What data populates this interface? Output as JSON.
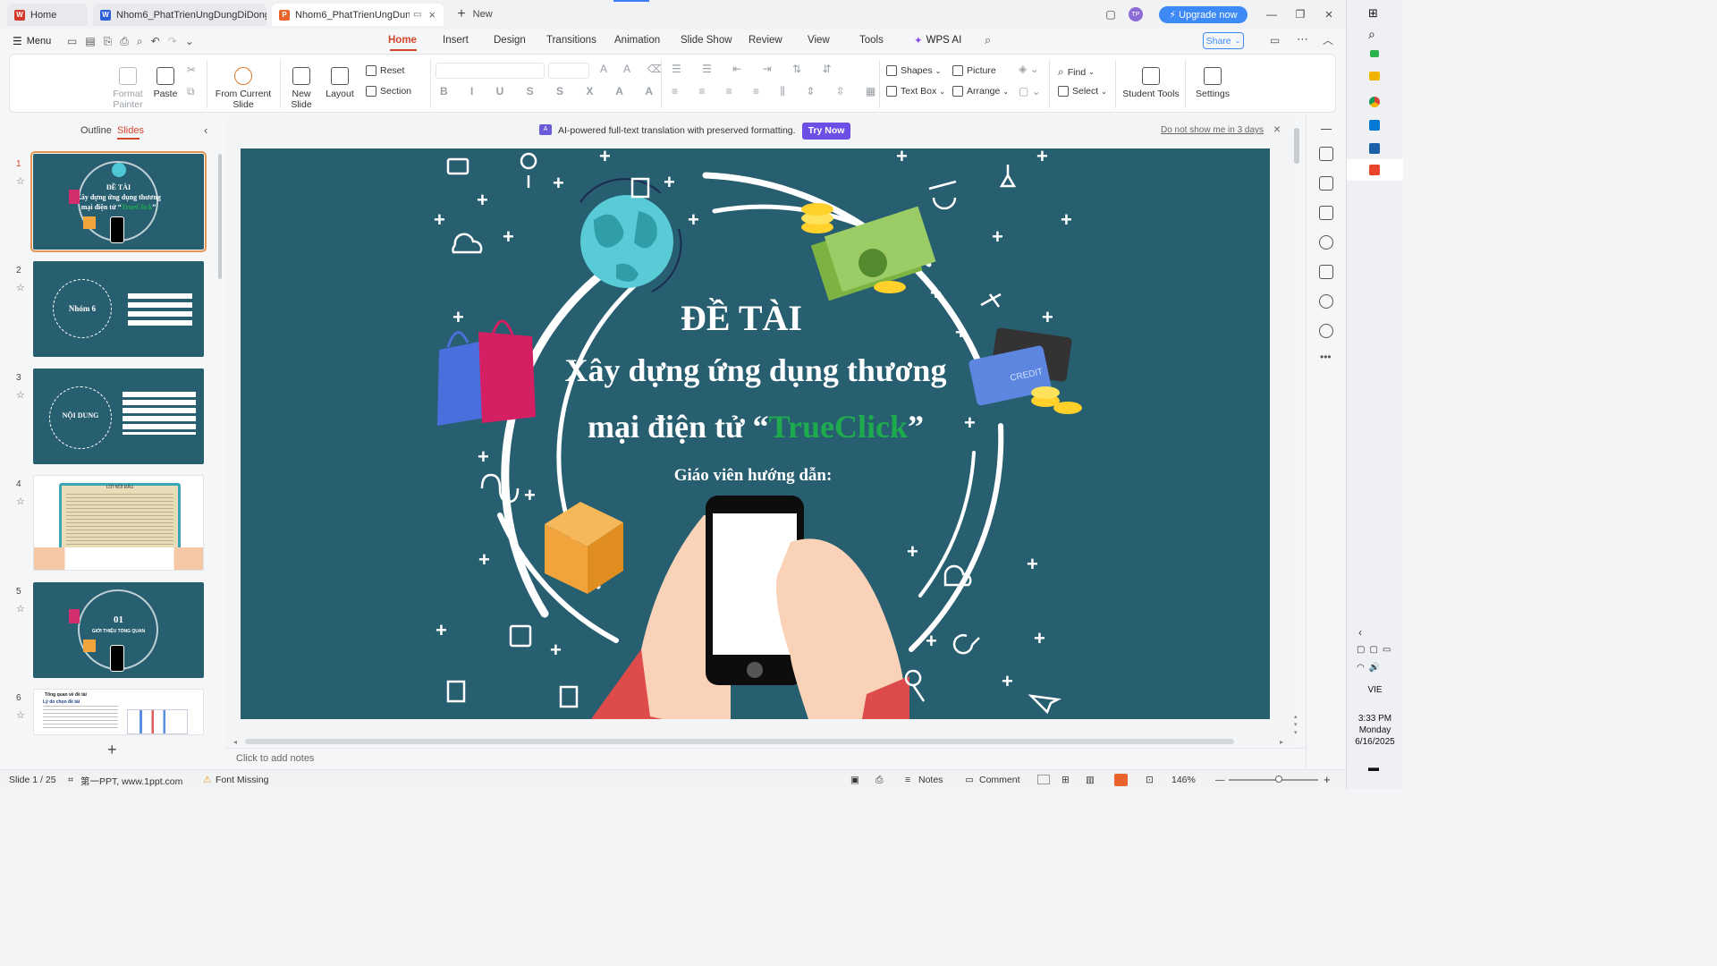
{
  "tabs": {
    "home": "Home",
    "doc1": "Nhom6_PhatTrienUngDungDiDong.d",
    "doc2": "Nhom6_PhatTrienUngDungDi",
    "new": "New",
    "upgrade": "Upgrade now",
    "avatar": "TP"
  },
  "menu": {
    "menu_label": "Menu",
    "tabs": [
      "Home",
      "Insert",
      "Design",
      "Transitions",
      "Animation",
      "Slide Show",
      "Review",
      "View",
      "Tools"
    ],
    "wps_ai": "WPS AI",
    "share": "Share"
  },
  "ribbon": {
    "format_painter": "Format Painter",
    "paste": "Paste",
    "from_current_slide": "From Current Slide",
    "new_slide": "New Slide",
    "layout": "Layout",
    "reset": "Reset",
    "section": "Section",
    "shapes": "Shapes",
    "picture": "Picture",
    "text_box": "Text Box",
    "arrange": "Arrange",
    "find": "Find",
    "select": "Select",
    "student_tools": "Student Tools",
    "settings": "Settings"
  },
  "panel": {
    "outline": "Outline",
    "slides": "Slides",
    "slide_numbers": [
      "1",
      "2",
      "3",
      "4",
      "5",
      "6"
    ],
    "thumb2_title": "Nhóm 6",
    "thumb3_title": "NỘI DUNG",
    "thumb4_title": "LỜI NÓI ĐẦU",
    "thumb5_num": "01",
    "thumb5_sub": "GIỚI THIỆU TỔNG QUAN",
    "thumb6_title": "Tổng quan về đề tài",
    "thumb6_sub": "Lý do chọn đề tài"
  },
  "banner": {
    "text": "AI-powered full-text translation with preserved formatting.",
    "try_now": "Try Now",
    "dismiss": "Do not show me in 3 days"
  },
  "slide": {
    "title": "ĐỀ TÀI",
    "line1": "Xây dựng ứng dụng thương",
    "line2_prefix": "mại điện tử “",
    "brand": "TrueClick",
    "line2_suffix": "”",
    "teacher": "Giáo viên hướng dẫn:",
    "card_text": "CREDIT",
    "bg_color": "#275e70",
    "brand_color": "#1eab4e"
  },
  "notes_placeholder": "Click to add notes",
  "status": {
    "slide_count": "Slide 1 / 25",
    "theme": "第一PPT, www.1ppt.com",
    "font_missing": "Font Missing",
    "notes": "Notes",
    "comment": "Comment",
    "zoom": "146%"
  },
  "taskbar": {
    "lang": "VIE",
    "time": "3:33 PM",
    "day": "Monday",
    "date": "6/16/2025"
  }
}
